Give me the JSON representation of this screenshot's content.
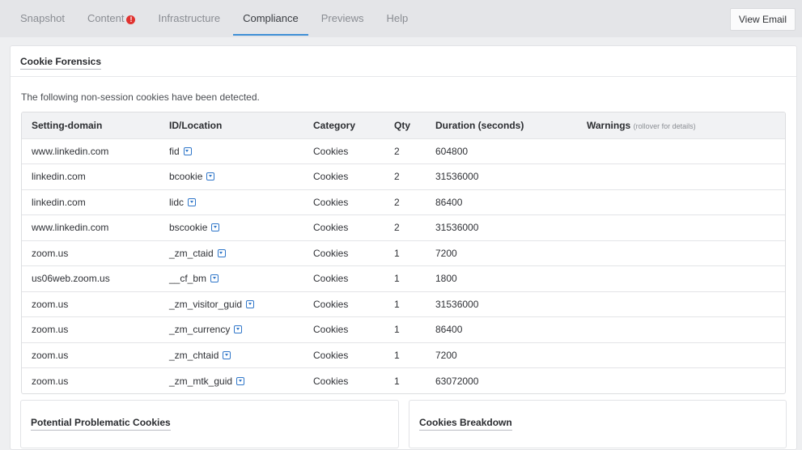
{
  "tabs": [
    {
      "label": "Snapshot"
    },
    {
      "label": "Content",
      "badge": "!"
    },
    {
      "label": "Infrastructure"
    },
    {
      "label": "Compliance",
      "active": true
    },
    {
      "label": "Previews"
    },
    {
      "label": "Help"
    }
  ],
  "view_email_label": "View Email",
  "section": {
    "title": "Cookie Forensics",
    "intro": "The following non-session cookies have been detected."
  },
  "table": {
    "headers": {
      "domain": "Setting-domain",
      "id": "ID/Location",
      "category": "Category",
      "qty": "Qty",
      "duration": "Duration (seconds)",
      "warnings": "Warnings",
      "warnings_hint": "(rollover for details)"
    },
    "rows": [
      {
        "domain": "www.linkedin.com",
        "id": "fid",
        "category": "Cookies",
        "qty": "2",
        "duration": "604800"
      },
      {
        "domain": "linkedin.com",
        "id": "bcookie",
        "category": "Cookies",
        "qty": "2",
        "duration": "31536000"
      },
      {
        "domain": "linkedin.com",
        "id": "lidc",
        "category": "Cookies",
        "qty": "2",
        "duration": "86400"
      },
      {
        "domain": "www.linkedin.com",
        "id": "bscookie",
        "category": "Cookies",
        "qty": "2",
        "duration": "31536000"
      },
      {
        "domain": "zoom.us",
        "id": "_zm_ctaid",
        "category": "Cookies",
        "qty": "1",
        "duration": "7200"
      },
      {
        "domain": "us06web.zoom.us",
        "id": "__cf_bm",
        "category": "Cookies",
        "qty": "1",
        "duration": "1800"
      },
      {
        "domain": "zoom.us",
        "id": "_zm_visitor_guid",
        "category": "Cookies",
        "qty": "1",
        "duration": "31536000"
      },
      {
        "domain": "zoom.us",
        "id": "_zm_currency",
        "category": "Cookies",
        "qty": "1",
        "duration": "86400"
      },
      {
        "domain": "zoom.us",
        "id": "_zm_chtaid",
        "category": "Cookies",
        "qty": "1",
        "duration": "7200"
      },
      {
        "domain": "zoom.us",
        "id": "_zm_mtk_guid",
        "category": "Cookies",
        "qty": "1",
        "duration": "63072000"
      }
    ]
  },
  "cards": {
    "problematic": "Potential Problematic Cookies",
    "breakdown": "Cookies Breakdown"
  },
  "colors": {
    "accent": "#3f8fd6",
    "badge": "#e0322f",
    "icon": "#2f76c9"
  },
  "icons": {
    "dropdown": "dropdown-icon",
    "alert": "alert-icon"
  }
}
